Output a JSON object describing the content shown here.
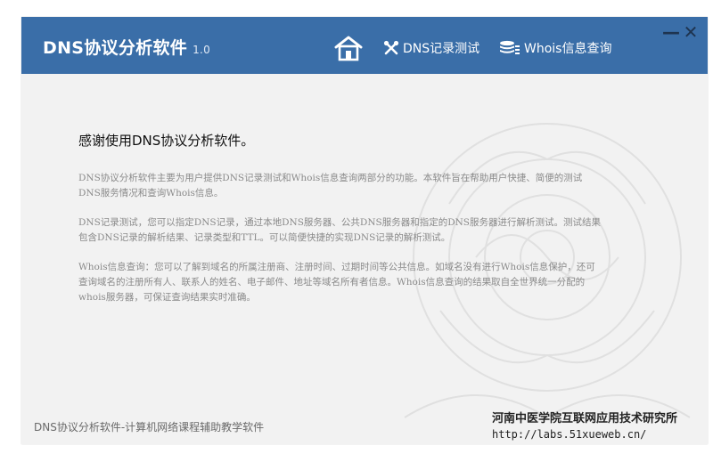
{
  "window": {
    "title": "DNS协议分析软件",
    "version": "1.0"
  },
  "nav": {
    "home": {
      "icon": "home-icon"
    },
    "dns_test": {
      "label": "DNS记录测试",
      "icon": "tools-icon"
    },
    "whois": {
      "label": "Whois信息查询",
      "icon": "database-icon"
    }
  },
  "controls": {
    "minimize": "—",
    "close": "✕"
  },
  "content": {
    "heading": "感谢使用DNS协议分析软件。",
    "paragraphs": [
      "DNS协议分析软件主要为用户提供DNS记录测试和Whois信息查询两部分的功能。本软件旨在帮助用户快捷、简便的测试DNS服务情况和查询Whois信息。",
      "DNS记录测试，您可以指定DNS记录，通过本地DNS服务器、公共DNS服务器和指定的DNS服务器进行解析测试。测试结果包含DNS记录的解析结果、记录类型和TTL。可以简便快捷的实现DNS记录的解析测试。",
      "Whois信息查询：您可以了解到域名的所属注册商、注册时间、过期时间等公共信息。如域名没有进行Whois信息保护，还可查询域名的注册所有人、联系人的姓名、电子邮件、地址等域名所有者信息。Whois信息查询的结果取自全世界统一分配的whois服务器，可保证查询结果实时准确。"
    ]
  },
  "footer": {
    "left": "DNS协议分析软件-计算机网络课程辅助教学软件",
    "org": "河南中医学院互联网应用技术研究所",
    "url": "http://labs.51xueweb.cn/"
  },
  "colors": {
    "titlebar": "#3a6ea8",
    "background": "#f2f2f2",
    "heading": "#111111",
    "body_text": "#8a8a8a"
  }
}
